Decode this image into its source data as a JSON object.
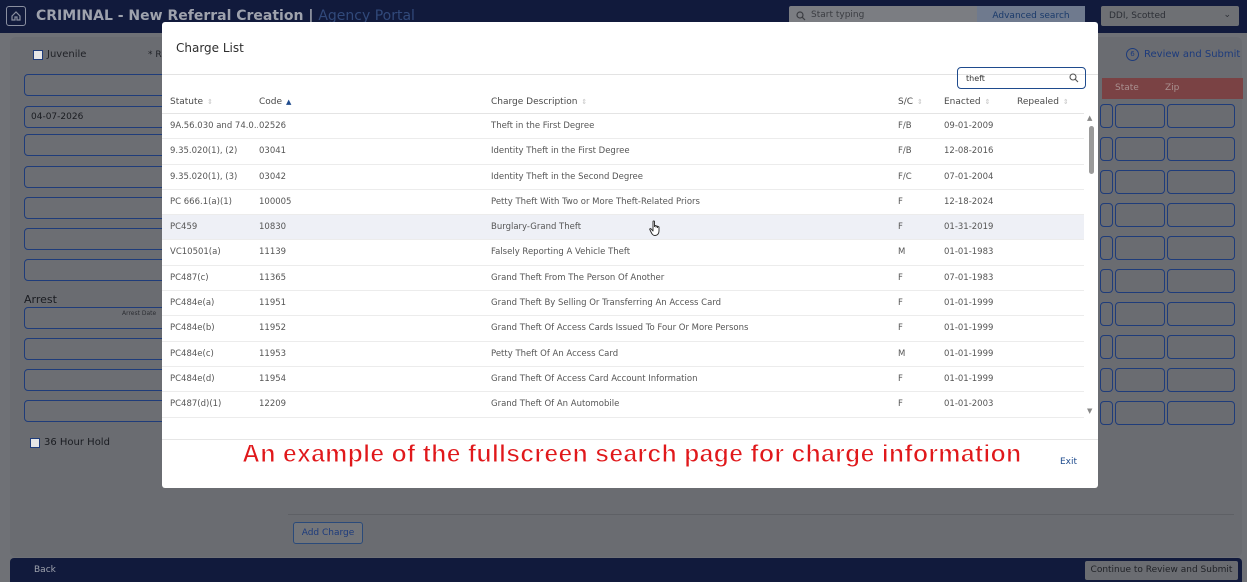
{
  "app": {
    "title": "CRIMINAL - New Referral Creation",
    "portal": "Agency Portal",
    "search_placeholder": "Start typing",
    "advanced_search": "Advanced search",
    "user": "DDI, Scotted"
  },
  "form": {
    "juvenile_label": "Juvenile",
    "required_label": "* R",
    "date_value": "04-07-2026",
    "arrest_heading": "Arrest",
    "arrest_date_label": "Arrest Date",
    "hold_label": "36 Hour Hold",
    "review_step_number": "6",
    "review_label": "Review and Submit",
    "state_header": "State",
    "zip_header": "Zip",
    "add_charge": "Add Charge",
    "back": "Back",
    "continue": "Continue to Review and Submit"
  },
  "modal": {
    "title": "Charge List",
    "search_value": "theft",
    "columns": {
      "statute": "Statute",
      "code": "Code",
      "description": "Charge Description",
      "sc": "S/C",
      "enacted": "Enacted",
      "repealed": "Repealed"
    },
    "rows": [
      {
        "statute": "9A.56.030 and 74.0...",
        "code": "02526",
        "description": "Theft in the First Degree",
        "sc": "F/B",
        "enacted": "09-01-2009",
        "repealed": ""
      },
      {
        "statute": "9.35.020(1), (2)",
        "code": "03041",
        "description": "Identity Theft in the First Degree",
        "sc": "F/B",
        "enacted": "12-08-2016",
        "repealed": ""
      },
      {
        "statute": "9.35.020(1), (3)",
        "code": "03042",
        "description": "Identity Theft in the Second Degree",
        "sc": "F/C",
        "enacted": "07-01-2004",
        "repealed": ""
      },
      {
        "statute": "PC 666.1(a)(1)",
        "code": "100005",
        "description": "Petty Theft With Two or More Theft-Related Priors",
        "sc": "F",
        "enacted": "12-18-2024",
        "repealed": ""
      },
      {
        "statute": "PC459",
        "code": "10830",
        "description": "Burglary-Grand Theft",
        "sc": "F",
        "enacted": "01-31-2019",
        "repealed": ""
      },
      {
        "statute": "VC10501(a)",
        "code": "11139",
        "description": "Falsely Reporting A Vehicle Theft",
        "sc": "M",
        "enacted": "01-01-1983",
        "repealed": ""
      },
      {
        "statute": "PC487(c)",
        "code": "11365",
        "description": "Grand Theft From The Person Of Another",
        "sc": "F",
        "enacted": "07-01-1983",
        "repealed": ""
      },
      {
        "statute": "PC484e(a)",
        "code": "11951",
        "description": "Grand Theft By Selling Or Transferring An Access Card",
        "sc": "F",
        "enacted": "01-01-1999",
        "repealed": ""
      },
      {
        "statute": "PC484e(b)",
        "code": "11952",
        "description": "Grand Theft Of Access Cards Issued To Four Or More Persons",
        "sc": "F",
        "enacted": "01-01-1999",
        "repealed": ""
      },
      {
        "statute": "PC484e(c)",
        "code": "11953",
        "description": "Petty Theft Of An Access Card",
        "sc": "M",
        "enacted": "01-01-1999",
        "repealed": ""
      },
      {
        "statute": "PC484e(d)",
        "code": "11954",
        "description": "Grand Theft Of Access Card Account Information",
        "sc": "F",
        "enacted": "01-01-1999",
        "repealed": ""
      },
      {
        "statute": "PC487(d)(1)",
        "code": "12209",
        "description": "Grand Theft Of An Automobile",
        "sc": "F",
        "enacted": "01-01-2003",
        "repealed": ""
      }
    ],
    "caption": "An example of the fullscreen search page for charge information",
    "exit": "Exit"
  }
}
